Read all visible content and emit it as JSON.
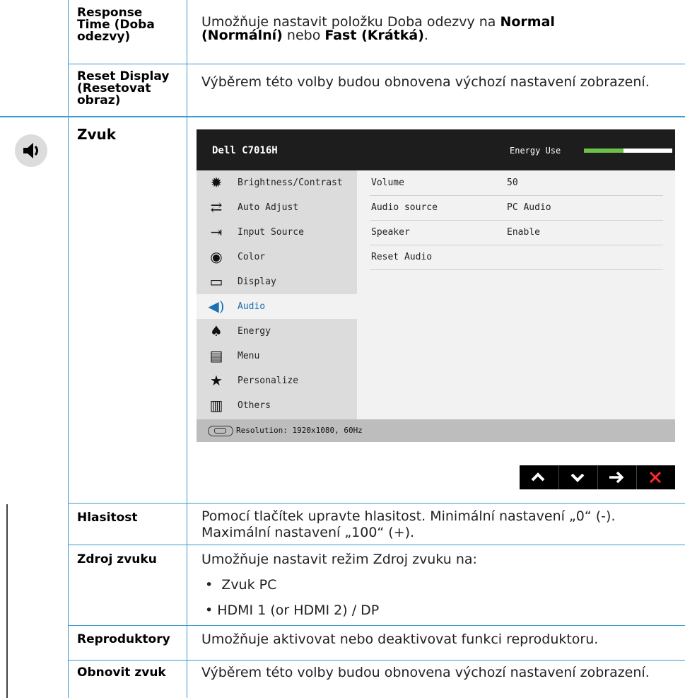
{
  "rows": {
    "response_time": {
      "label": "Response Time (Doba odezvy)",
      "label_lines": [
        "Response",
        "Time (Doba",
        "odezvy)"
      ],
      "desc_prefix": "Umožňuje nastavit položku Doba odezvy na ",
      "desc_bold1": "Normal (Normální)",
      "desc_mid": " nebo ",
      "desc_bold2": "Fast (Krátká)",
      "desc_suffix": "."
    },
    "reset_display": {
      "label_lines": [
        "Reset Display",
        "(Resetovat",
        "obraz)"
      ],
      "desc": "Výběrem této volby budou obnovena výchozí nastavení zobrazení."
    },
    "audio": {
      "label": "Zvuk",
      "icon": "speaker-icon"
    },
    "volume": {
      "label": "Hlasitost",
      "desc": "Pomocí tlačítek upravte hlasitost. Minimální nastavení „0“ (-). Maximální nastavení „100“ (+)."
    },
    "audio_source": {
      "label": "Zdroj zvuku",
      "desc": "Umožňuje nastavit režim Zdroj zvuku na:",
      "bullets": [
        "Zvuk PC",
        "HDMI 1 (or HDMI 2) / DP"
      ]
    },
    "speaker": {
      "label": "Reproduktory",
      "desc": "Umožňuje aktivovat nebo deaktivovat funkci reproduktoru."
    },
    "reset_audio": {
      "label": "Obnovit zvuk",
      "desc": "Výběrem této volby budou obnovena výchozí nastavení zobrazení."
    }
  },
  "osd": {
    "model": "Dell C7016H",
    "energy_label": "Energy Use",
    "energy_level": 0.45,
    "menu": [
      {
        "label": "Brightness/Contrast",
        "icon": "brightness-icon"
      },
      {
        "label": "Auto Adjust",
        "icon": "auto-adjust-icon"
      },
      {
        "label": "Input Source",
        "icon": "input-source-icon"
      },
      {
        "label": "Color",
        "icon": "color-icon"
      },
      {
        "label": "Display",
        "icon": "display-icon"
      },
      {
        "label": "Audio",
        "icon": "audio-icon",
        "active": true
      },
      {
        "label": "Energy",
        "icon": "energy-icon"
      },
      {
        "label": "Menu",
        "icon": "menu-icon"
      },
      {
        "label": "Personalize",
        "icon": "star-icon"
      },
      {
        "label": "Others",
        "icon": "others-icon"
      }
    ],
    "settings": [
      {
        "key": "Volume",
        "value": "50"
      },
      {
        "key": "Audio source",
        "value": "PC Audio"
      },
      {
        "key": "Speaker",
        "value": "Enable"
      },
      {
        "key": "Reset Audio",
        "value": ""
      }
    ],
    "resolution": "Resolution: 1920x1080, 60Hz",
    "buttons": [
      {
        "label": "^",
        "icon": "chevron-up-icon"
      },
      {
        "label": "v",
        "icon": "chevron-down-icon"
      },
      {
        "label": "→",
        "icon": "arrow-right-icon"
      },
      {
        "label": "X",
        "icon": "close-icon"
      }
    ],
    "colors": {
      "energy_fill": "#6cc04a",
      "active": "#1b6fb5",
      "close": "#ff2a2a",
      "rule": "#3a9bd0"
    }
  }
}
